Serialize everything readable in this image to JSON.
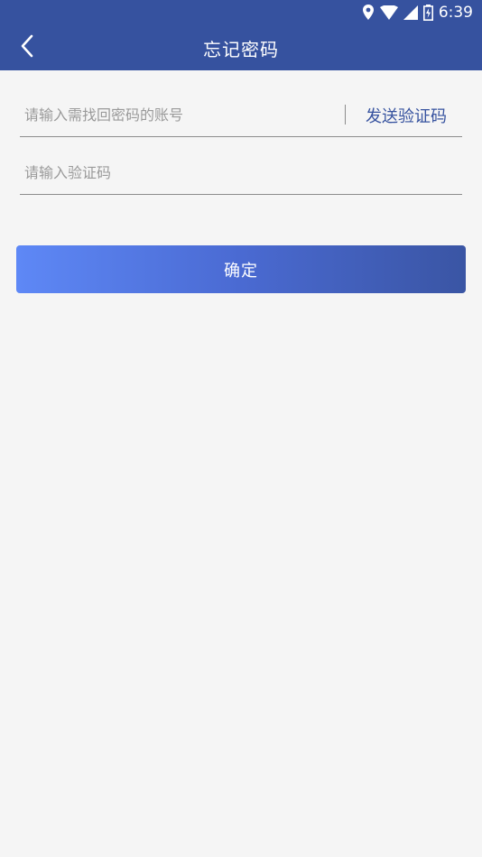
{
  "status_bar": {
    "time": "6:39",
    "icons": [
      "location-icon",
      "wifi-icon",
      "signal-icon",
      "battery-charging-icon"
    ]
  },
  "app_bar": {
    "title": "忘记密码",
    "back_icon": "chevron-left-icon"
  },
  "form": {
    "account_placeholder": "请输入需找回密码的账号",
    "account_value": "",
    "send_code_label": "发送验证码",
    "code_placeholder": "请输入验证码",
    "code_value": ""
  },
  "confirm_label": "确定",
  "colors": {
    "primary": "#36529f",
    "button_gradient_start": "#5e88f6",
    "button_gradient_end": "#3a55a4",
    "background": "#f5f5f5"
  }
}
